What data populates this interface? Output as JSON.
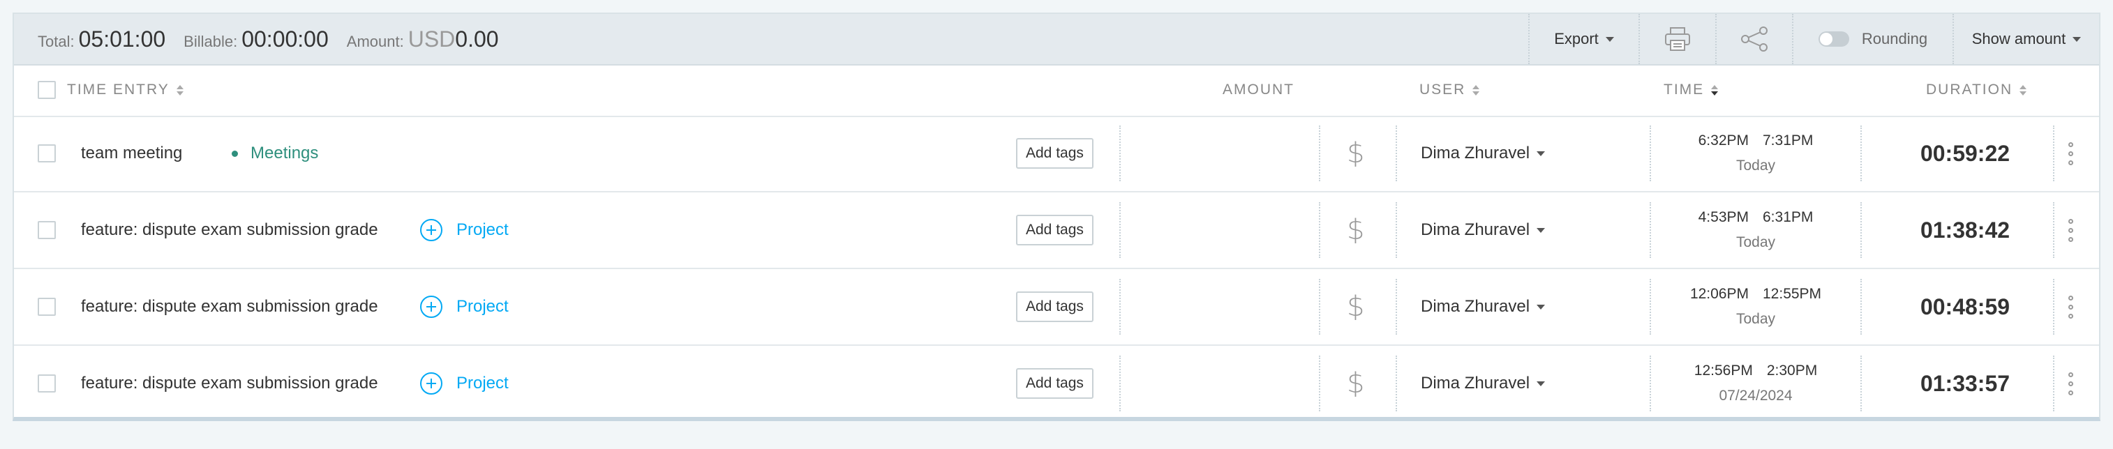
{
  "summary": {
    "total_label": "Total:",
    "total_value": "05:01:00",
    "billable_label": "Billable:",
    "billable_value": "00:00:00",
    "amount_label": "Amount:",
    "amount_currency": "USD",
    "amount_value": "0.00",
    "export_label": "Export",
    "print_icon": "printer-icon",
    "share_icon": "share-icon",
    "rounding_label": "Rounding",
    "rounding_on": false,
    "show_amount_label": "Show amount"
  },
  "columns": {
    "time_entry": "TIME ENTRY",
    "amount": "AMOUNT",
    "user": "USER",
    "time": "TIME",
    "duration": "DURATION"
  },
  "colors": {
    "project_meetings": "#2e8f7d",
    "add_project": "#03a9f4"
  },
  "rows": [
    {
      "description": "team meeting",
      "project": "Meetings",
      "has_project": true,
      "add_tags": "Add tags",
      "user": "Dima Zhuravel",
      "start": "6:32PM",
      "end": "7:31PM",
      "date": "Today",
      "duration": "00:59:22"
    },
    {
      "description": "feature: dispute exam submission grade",
      "project": "Project",
      "has_project": false,
      "add_tags": "Add tags",
      "user": "Dima Zhuravel",
      "start": "4:53PM",
      "end": "6:31PM",
      "date": "Today",
      "duration": "01:38:42"
    },
    {
      "description": "feature: dispute exam submission grade",
      "project": "Project",
      "has_project": false,
      "add_tags": "Add tags",
      "user": "Dima Zhuravel",
      "start": "12:06PM",
      "end": "12:55PM",
      "date": "Today",
      "duration": "00:48:59"
    },
    {
      "description": "feature: dispute exam submission grade",
      "project": "Project",
      "has_project": false,
      "add_tags": "Add tags",
      "user": "Dima Zhuravel",
      "start": "12:56PM",
      "end": "2:30PM",
      "date": "07/24/2024",
      "duration": "01:33:57"
    }
  ]
}
